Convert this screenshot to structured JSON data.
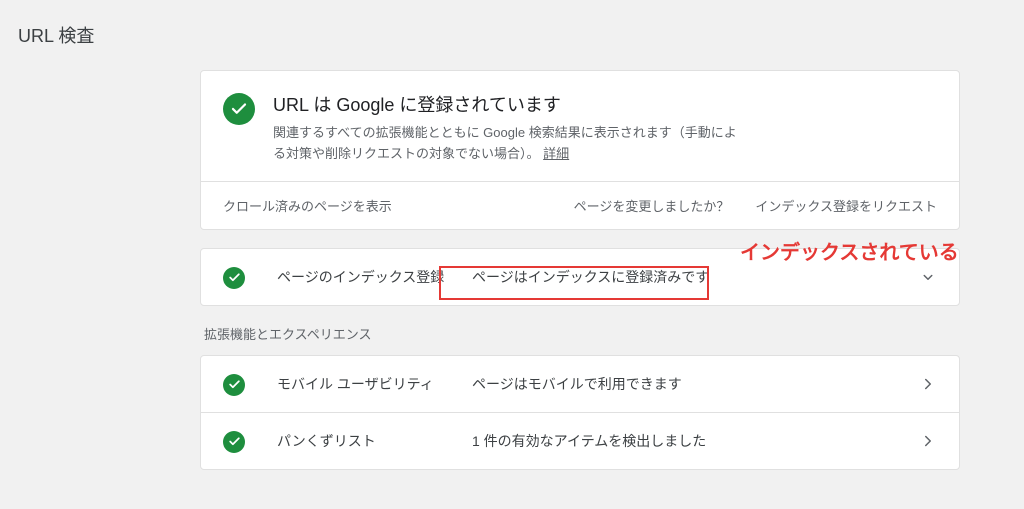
{
  "page_title": "URL 検査",
  "summary": {
    "title": "URL は Google に登録されています",
    "description_line1": "関連するすべての拡張機能とともに Google 検索結果に表示されます（手動によ",
    "description_line2": "る対策や削除リクエストの対象でない場合）。",
    "details_link": "詳細"
  },
  "actions": {
    "view_crawled": "クロール済みのページを表示",
    "changed": "ページを変更しましたか？",
    "request_index": "インデックス登録をリクエスト"
  },
  "index_row": {
    "label": "ページのインデックス登録",
    "value": "ページはインデックスに登録済みです"
  },
  "annotation_text": "インデックスされている",
  "section_heading": "拡張機能とエクスペリエンス",
  "rows": [
    {
      "label": "モバイル ユーザビリティ",
      "value": "ページはモバイルで利用できます"
    },
    {
      "label": "パンくずリスト",
      "value": "1 件の有効なアイテムを検出しました"
    }
  ]
}
